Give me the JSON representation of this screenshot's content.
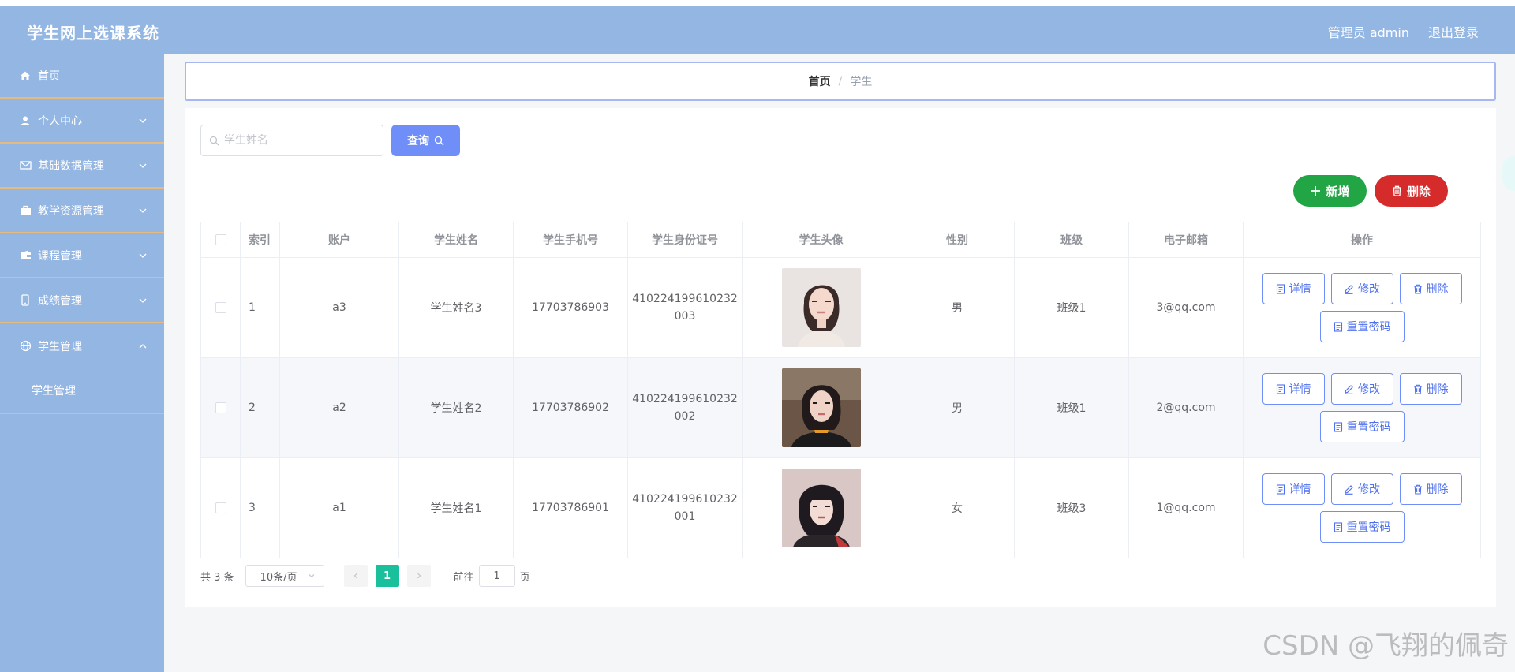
{
  "app": {
    "title": "学生网上选课系统"
  },
  "header": {
    "user_label": "管理员 admin",
    "logout_label": "退出登录"
  },
  "sidebar": {
    "items": [
      {
        "label": "首页",
        "icon": "home-icon"
      },
      {
        "label": "个人中心",
        "icon": "user-icon"
      },
      {
        "label": "基础数据管理",
        "icon": "mail-icon"
      },
      {
        "label": "教学资源管理",
        "icon": "briefcase-icon"
      },
      {
        "label": "课程管理",
        "icon": "wallet-icon"
      },
      {
        "label": "成绩管理",
        "icon": "phone-icon"
      },
      {
        "label": "学生管理",
        "icon": "globe-icon"
      }
    ],
    "subitems": [
      {
        "label": "学生管理"
      }
    ]
  },
  "breadcrumb": {
    "home": "首页",
    "separator": "/",
    "current": "学生"
  },
  "search": {
    "placeholder": "学生姓名",
    "value": "",
    "button_label": "查询"
  },
  "actions": {
    "add_label": "新增",
    "delete_label": "删除"
  },
  "table": {
    "columns": [
      "索引",
      "账户",
      "学生姓名",
      "学生手机号",
      "学生身份证号",
      "学生头像",
      "性别",
      "班级",
      "电子邮箱",
      "操作"
    ],
    "rows": [
      {
        "index": "1",
        "account": "a3",
        "name": "学生姓名3",
        "phone": "17703786903",
        "id_line1": "410224199610232",
        "id_line2": "003",
        "gender": "男",
        "class": "班级1",
        "email": "3@qq.com"
      },
      {
        "index": "2",
        "account": "a2",
        "name": "学生姓名2",
        "phone": "17703786902",
        "id_line1": "410224199610232",
        "id_line2": "002",
        "gender": "男",
        "class": "班级1",
        "email": "2@qq.com"
      },
      {
        "index": "3",
        "account": "a1",
        "name": "学生姓名1",
        "phone": "17703786901",
        "id_line1": "410224199610232",
        "id_line2": "001",
        "gender": "女",
        "class": "班级3",
        "email": "1@qq.com"
      }
    ],
    "row_actions": {
      "detail": "详情",
      "edit": "修改",
      "delete": "删除",
      "reset": "重置密码"
    }
  },
  "pagination": {
    "total_label": "共 3 条",
    "page_size": "10条/页",
    "current_page": "1",
    "goto_label": "前往",
    "goto_value": "1",
    "page_suffix": "页"
  },
  "watermark": "CSDN @飞翔的佩奇",
  "colors": {
    "header_bg": "#94b6e3",
    "sidebar_border": "#e6b980",
    "primary": "#6f8ef7",
    "success": "#22a645",
    "danger": "#d52b2b",
    "pager_active": "#19c09b"
  }
}
